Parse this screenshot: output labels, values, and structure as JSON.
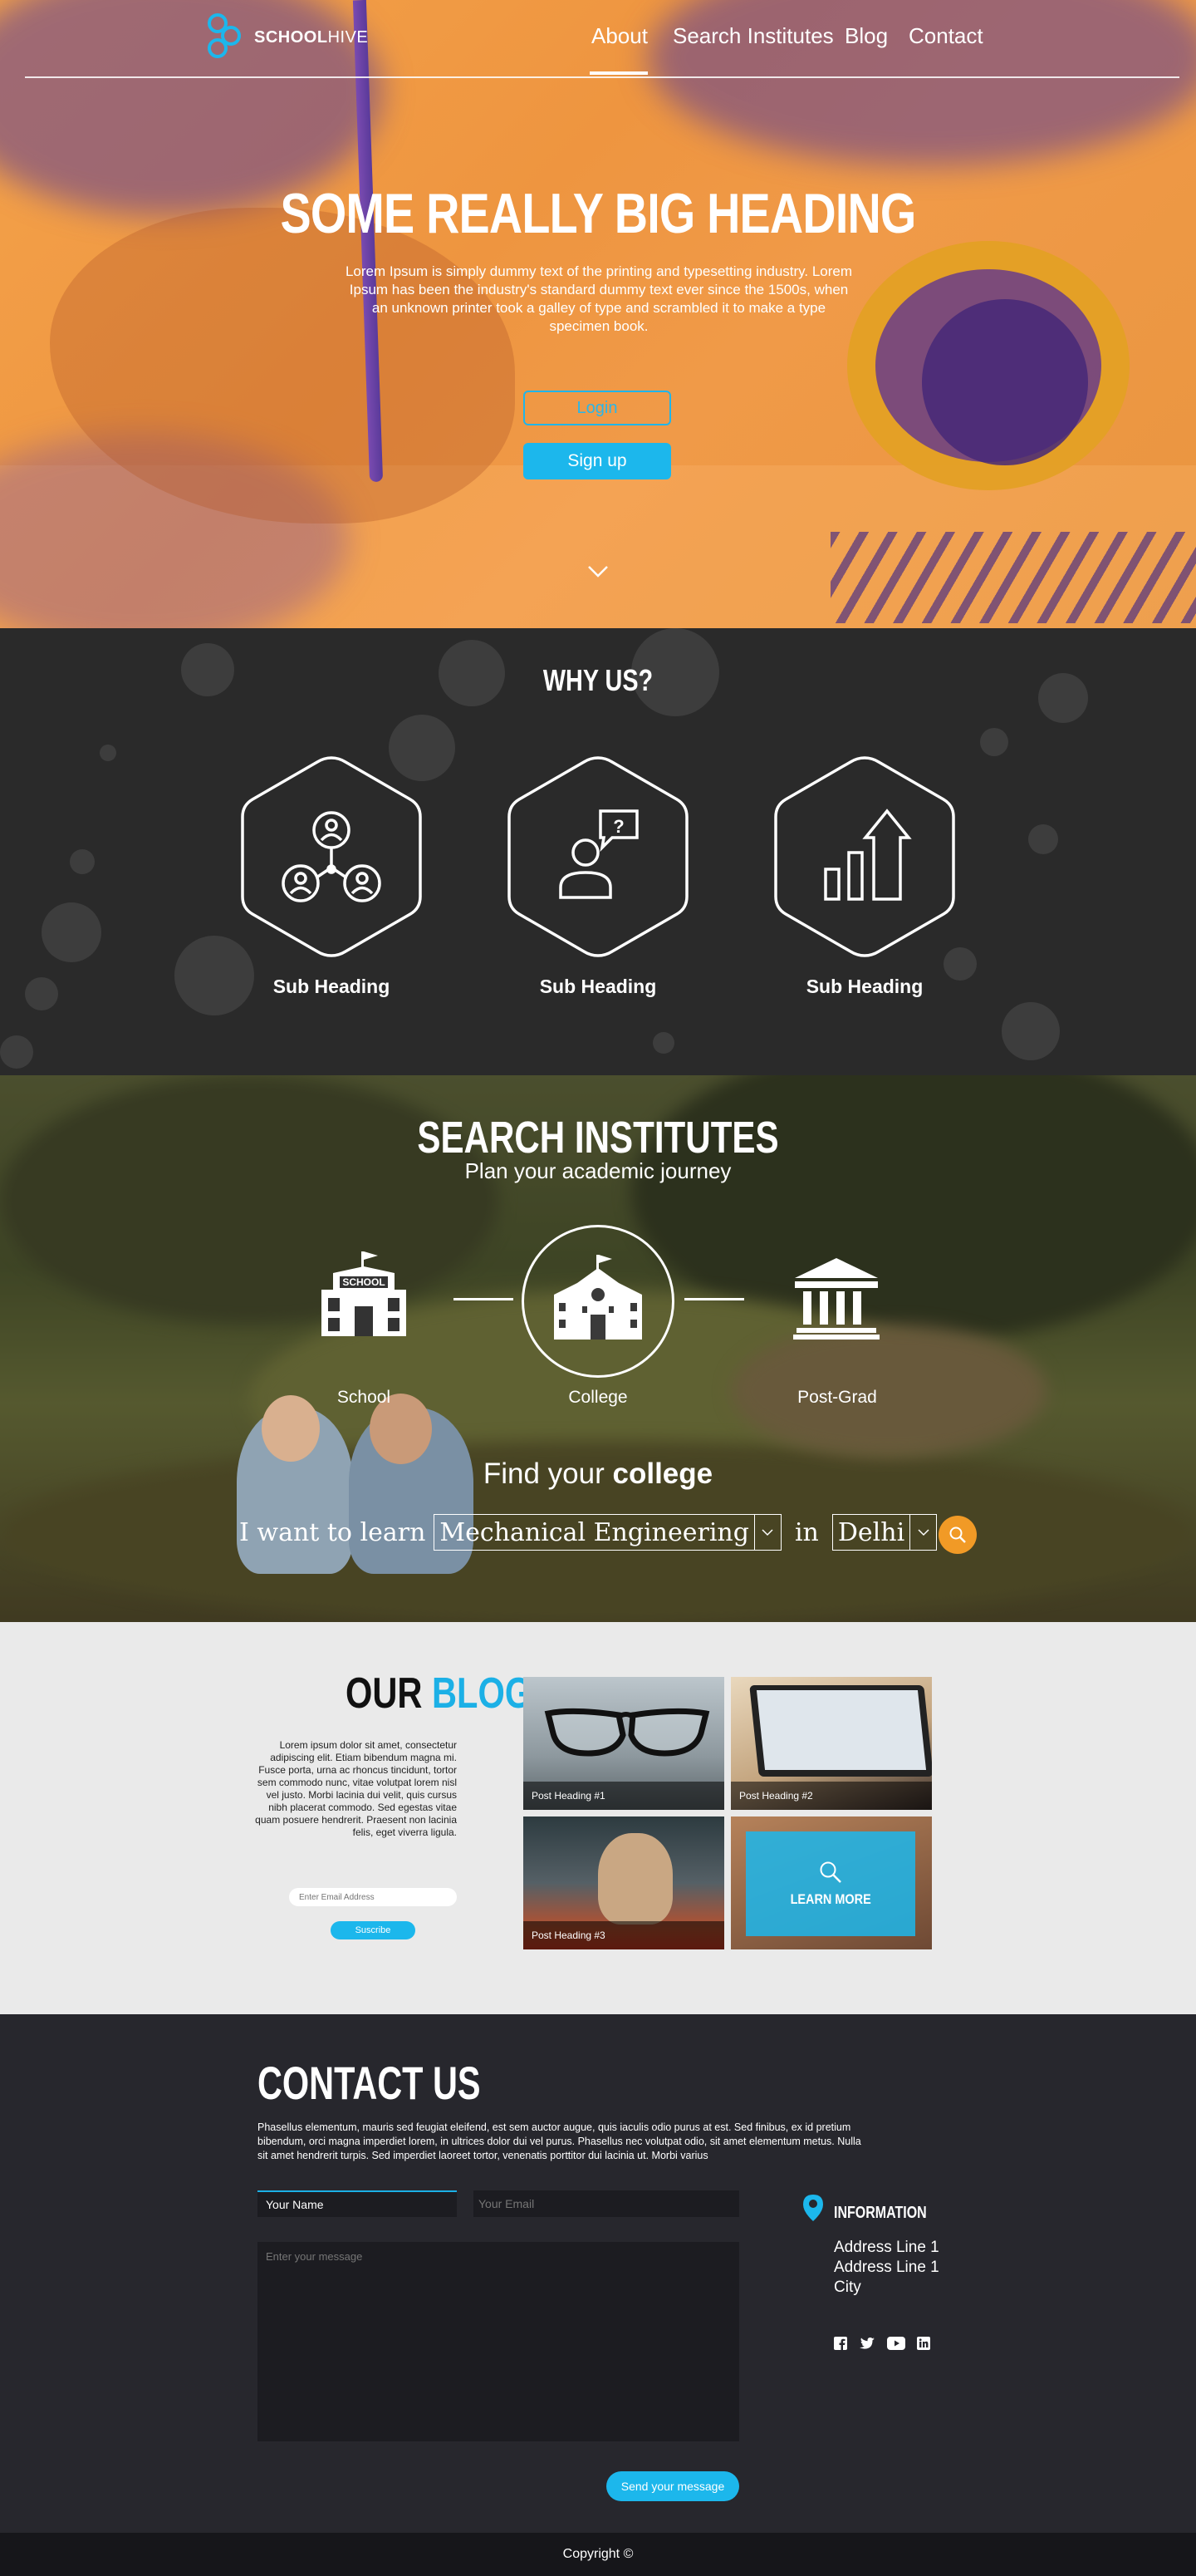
{
  "header": {
    "logo_bold": "SCHOOL",
    "logo_light": "HIVE",
    "nav": [
      "About",
      "Search Institutes",
      "Blog",
      "Contact"
    ],
    "active_nav": "About"
  },
  "hero": {
    "title": "SOME REALLY BIG HEADING",
    "text": "Lorem Ipsum is simply dummy text of the printing and typesetting industry. Lorem Ipsum has been the industry's standard dummy text ever since the 1500s, when an unknown printer took a galley of type and scrambled it to make a type specimen book.",
    "login_label": "Login",
    "signup_label": "Sign up"
  },
  "why": {
    "title": "WHY US?",
    "items": [
      {
        "icon": "network-users-icon",
        "label": "Sub Heading"
      },
      {
        "icon": "person-question-icon",
        "label": "Sub Heading"
      },
      {
        "icon": "growth-chart-icon",
        "label": "Sub Heading"
      }
    ]
  },
  "search": {
    "title": "SEARCH INSTITUTES",
    "subtitle": "Plan your academic journey",
    "levels": [
      {
        "icon": "school-building-icon",
        "label": "School",
        "sign": "SCHOOL"
      },
      {
        "icon": "college-building-icon",
        "label": "College"
      },
      {
        "icon": "university-columns-icon",
        "label": "Post-Grad"
      }
    ],
    "selected_level": "College",
    "find_prefix": "Find your",
    "find_bold": "college",
    "want_label": "I want to learn",
    "subject": "Mechanical Engineering",
    "in_label": "in",
    "city": "Delhi"
  },
  "blog": {
    "title_a": "OUR",
    "title_b": "BLOG",
    "text": "Lorem ipsum dolor sit amet, consectetur adipiscing elit. Etiam bibendum magna mi. Fusce porta, urna ac rhoncus tincidunt, tortor sem commodo nunc, vitae volutpat lorem nisl vel justo. Morbi lacinia dui velit, quis cursus nibh placerat commodo. Sed egestas vitae quam posuere hendrerit. Praesent non lacinia felis, eget viverra ligula.",
    "email_placeholder": "Enter Email Address",
    "subscribe_label": "Suscribe",
    "posts": [
      "Post Heading #1",
      "Post Heading #2",
      "Post Heading #3"
    ],
    "learn_more": "LEARN MORE"
  },
  "contact": {
    "title": "CONTACT US",
    "text": "Phasellus elementum, mauris sed feugiat eleifend, est sem auctor augue, quis iaculis odio purus at est. Sed finibus, ex id pretium bibendum, orci magna imperdiet lorem, in ultrices dolor dui vel purus. Phasellus nec volutpat odio, sit amet elementum metus. Nulla sit amet hendrerit turpis. Sed imperdiet laoreet tortor, venenatis porttitor dui lacinia ut. Morbi varius",
    "name_value": "Your Name",
    "email_placeholder": "Your Email",
    "message_placeholder": "Enter your message",
    "send_label": "Send your message",
    "info_title": "INFORMATION",
    "address": [
      "Address Line 1",
      "Address Line 1",
      "City"
    ],
    "socials": [
      "facebook-icon",
      "twitter-icon",
      "youtube-icon",
      "linkedin-icon"
    ]
  },
  "footer": {
    "copyright": "Copyright ©"
  },
  "colors": {
    "accent": "#1cb7ec",
    "hero_orange": "#f09a45",
    "search_button": "#f19a26",
    "dark_bg": "#2a2a2a",
    "contact_bg": "#27272d"
  }
}
